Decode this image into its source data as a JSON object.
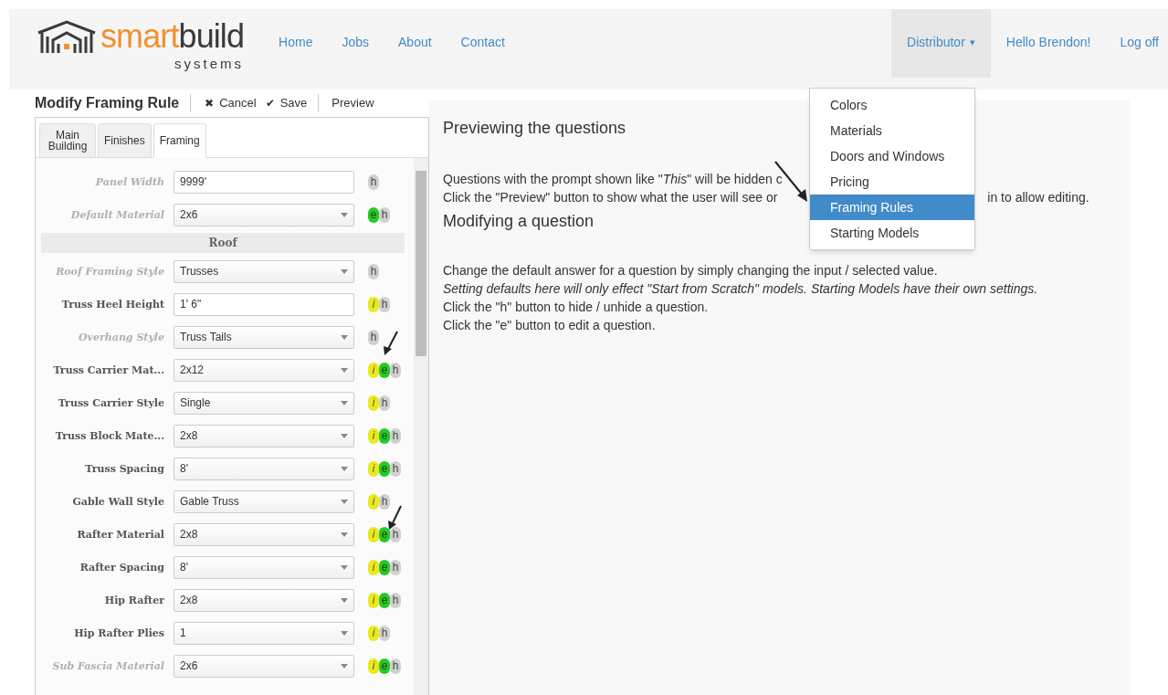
{
  "brand": {
    "name_part_1": "smart",
    "name_part_2": "build",
    "tagline": "systems"
  },
  "nav": {
    "links": [
      "Home",
      "Jobs",
      "About",
      "Contact"
    ],
    "distributor": {
      "label": "Distributor",
      "caret": "▾",
      "expanded": true
    },
    "greeting": "Hello Brendon!",
    "logoff": "Log off"
  },
  "menu": {
    "items": [
      {
        "label": "Colors",
        "selected": false
      },
      {
        "label": "Materials",
        "selected": false
      },
      {
        "label": "Doors and Windows",
        "selected": false
      },
      {
        "label": "Pricing",
        "selected": false
      },
      {
        "label": "Framing Rules",
        "selected": true
      },
      {
        "label": "Starting Models",
        "selected": false
      }
    ]
  },
  "toolbar": {
    "title": "Modify Framing Rule",
    "cancel": {
      "icon": "✖",
      "label": "Cancel"
    },
    "save": {
      "icon": "✔",
      "label": "Save"
    },
    "preview": "Preview"
  },
  "tabs": [
    {
      "label": "Main Building",
      "selected": false
    },
    {
      "label": "Finishes",
      "selected": false
    },
    {
      "label": "Framing",
      "selected": true
    }
  ],
  "form": [
    {
      "kind": "text",
      "label": "Panel Width",
      "hidden": true,
      "value": "9999'",
      "badges": [
        {
          "kind": "h",
          "text": "h"
        }
      ]
    },
    {
      "kind": "select",
      "label": "Default Material",
      "hidden": true,
      "value": "2x6",
      "badges": [
        {
          "kind": "e",
          "text": "e"
        },
        {
          "kind": "h",
          "text": "h"
        }
      ]
    },
    {
      "kind": "section",
      "label": "Roof"
    },
    {
      "kind": "select",
      "label": "Roof Framing Style",
      "hidden": true,
      "value": "Trusses",
      "badges": [
        {
          "kind": "h",
          "text": "h"
        }
      ]
    },
    {
      "kind": "text",
      "label": "Truss Heel Height",
      "hidden": false,
      "value": "1' 6\"",
      "badges": [
        {
          "kind": "i",
          "text": "i"
        },
        {
          "kind": "h",
          "text": "h"
        }
      ]
    },
    {
      "kind": "select",
      "label": "Overhang Style",
      "hidden": true,
      "value": "Truss Tails",
      "badges": [
        {
          "kind": "h",
          "text": "h"
        }
      ]
    },
    {
      "kind": "select",
      "label": "Truss Carrier Mat...",
      "hidden": false,
      "value": "2x12",
      "badges": [
        {
          "kind": "i",
          "text": "i"
        },
        {
          "kind": "e",
          "text": "e"
        },
        {
          "kind": "h",
          "text": "h"
        }
      ]
    },
    {
      "kind": "select",
      "label": "Truss Carrier Style",
      "hidden": false,
      "value": "Single",
      "badges": [
        {
          "kind": "i",
          "text": "i"
        },
        {
          "kind": "h",
          "text": "h"
        }
      ]
    },
    {
      "kind": "select",
      "label": "Truss Block Mate...",
      "hidden": false,
      "value": "2x8",
      "badges": [
        {
          "kind": "i",
          "text": "i"
        },
        {
          "kind": "e",
          "text": "e"
        },
        {
          "kind": "h",
          "text": "h"
        }
      ]
    },
    {
      "kind": "select",
      "label": "Truss Spacing",
      "hidden": false,
      "value": "8'",
      "badges": [
        {
          "kind": "i",
          "text": "i"
        },
        {
          "kind": "e",
          "text": "e"
        },
        {
          "kind": "h",
          "text": "h"
        }
      ]
    },
    {
      "kind": "select",
      "label": "Gable Wall Style",
      "hidden": false,
      "value": "Gable Truss",
      "badges": [
        {
          "kind": "i",
          "text": "i"
        },
        {
          "kind": "h",
          "text": "h"
        }
      ]
    },
    {
      "kind": "select",
      "label": "Rafter Material",
      "hidden": false,
      "value": "2x8",
      "badges": [
        {
          "kind": "i",
          "text": "i"
        },
        {
          "kind": "e",
          "text": "e"
        },
        {
          "kind": "h",
          "text": "h"
        }
      ]
    },
    {
      "kind": "select",
      "label": "Rafter Spacing",
      "hidden": false,
      "value": "8'",
      "badges": [
        {
          "kind": "i",
          "text": "i"
        },
        {
          "kind": "e",
          "text": "e"
        },
        {
          "kind": "h",
          "text": "h"
        }
      ]
    },
    {
      "kind": "select",
      "label": "Hip Rafter",
      "hidden": false,
      "value": "2x8",
      "badges": [
        {
          "kind": "i",
          "text": "i"
        },
        {
          "kind": "e",
          "text": "e"
        },
        {
          "kind": "h",
          "text": "h"
        }
      ]
    },
    {
      "kind": "select",
      "label": "Hip Rafter Plies",
      "hidden": false,
      "value": "1",
      "badges": [
        {
          "kind": "i",
          "text": "i"
        },
        {
          "kind": "h",
          "text": "h"
        }
      ]
    },
    {
      "kind": "select",
      "label": "Sub Fascia Material",
      "hidden": true,
      "value": "2x6",
      "badges": [
        {
          "kind": "i",
          "text": "i"
        },
        {
          "kind": "e",
          "text": "e"
        },
        {
          "kind": "h",
          "text": "h"
        }
      ]
    }
  ],
  "help": {
    "heading_1": "Previewing the questions",
    "line_1": "Questions with the prompt shown like \"*This*\" will be hidden c",
    "line_2_start": "Click the \"Preview\" button to show what the user will see or",
    "line_2_end": "in to allow editing.",
    "heading_2": "Modifying a question",
    "lines": [
      {
        "kind": "normal",
        "text": "Change the default answer for a question by simply changing the input / selected value."
      },
      {
        "kind": "italic",
        "text": "Setting defaults here will only effect \"Start from Scratch\" models. Starting Models have their own settings."
      },
      {
        "kind": "normal",
        "text": "Click the \"h\" button to hide / unhide a question."
      },
      {
        "kind": "normal",
        "text": "Click the \"e\" button to edit a question."
      }
    ]
  }
}
